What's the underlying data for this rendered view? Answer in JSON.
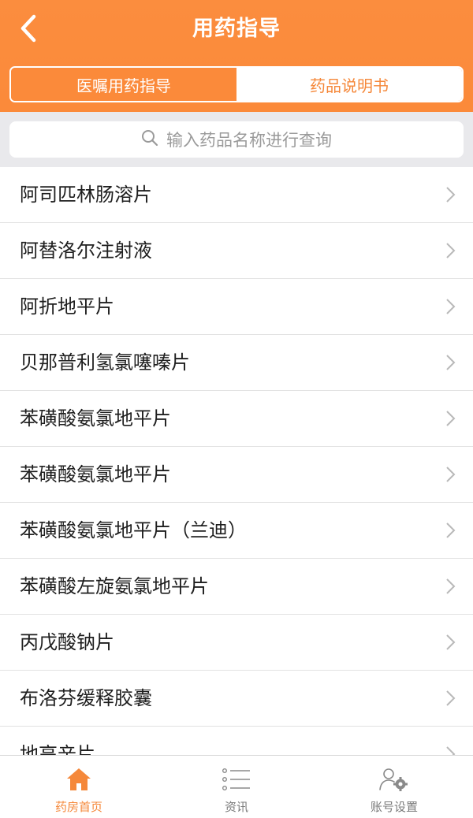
{
  "header": {
    "title": "用药指导",
    "back_icon": "chevron-left-icon"
  },
  "segment": {
    "tabs": [
      {
        "label": "医嘱用药指导",
        "active": true
      },
      {
        "label": "药品说明书",
        "active": false
      }
    ]
  },
  "search": {
    "placeholder": "输入药品名称进行查询",
    "icon": "search-icon"
  },
  "drug_list": {
    "items": [
      {
        "name": "阿司匹林肠溶片"
      },
      {
        "name": "阿替洛尔注射液"
      },
      {
        "name": "阿折地平片"
      },
      {
        "name": "贝那普利氢氯噻嗪片"
      },
      {
        "name": "苯磺酸氨氯地平片"
      },
      {
        "name": "苯磺酸氨氯地平片"
      },
      {
        "name": "苯磺酸氨氯地平片（兰迪）"
      },
      {
        "name": "苯磺酸左旋氨氯地平片"
      },
      {
        "name": "丙戊酸钠片"
      },
      {
        "name": "布洛芬缓释胶囊"
      },
      {
        "name": "地高辛片"
      }
    ],
    "chevron_icon": "chevron-right-icon"
  },
  "tabbar": {
    "items": [
      {
        "label": "药房首页",
        "icon": "home-icon",
        "active": true
      },
      {
        "label": "资讯",
        "icon": "list-icon",
        "active": false
      },
      {
        "label": "账号设置",
        "icon": "user-settings-icon",
        "active": false
      }
    ]
  },
  "colors": {
    "accent": "#FB8A3A",
    "header_bg": "#FB8A3A",
    "search_bg": "#E9E9EC",
    "text_primary": "#1E1E1E",
    "text_muted": "#9A9A9A",
    "divider": "#E2E2E2"
  }
}
